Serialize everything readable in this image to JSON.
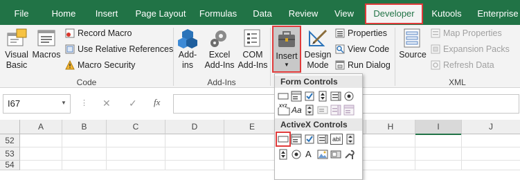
{
  "colors": {
    "brand": "#217346",
    "highlight": "#e03a3a"
  },
  "tabs": [
    "File",
    "Home",
    "Insert",
    "Page Layout",
    "Formulas",
    "Data",
    "Review",
    "View",
    "Developer",
    "Kutools",
    "Enterprise"
  ],
  "active_tab": "Developer",
  "code_group": {
    "label": "Code",
    "visual_basic": [
      "Visual",
      "Basic"
    ],
    "macros": "Macros",
    "record_macro": "Record Macro",
    "use_relative": "Use Relative References",
    "macro_security": "Macro Security"
  },
  "addins_group": {
    "label": "Add-Ins",
    "addins": [
      "Add-",
      "ins"
    ],
    "excel_addins": [
      "Excel",
      "Add-Ins"
    ],
    "com_addins": [
      "COM",
      "Add-Ins"
    ]
  },
  "controls_group": {
    "insert": "Insert",
    "design_mode": [
      "Design",
      "Mode"
    ],
    "properties": "Properties",
    "view_code": "View Code",
    "run_dialog": "Run Dialog"
  },
  "xml_group": {
    "label": "XML",
    "source": "Source",
    "map_properties": "Map Properties",
    "expansion_packs": "Expansion Packs",
    "refresh_data": "Refresh Data"
  },
  "formula_bar": {
    "name_box": "I67",
    "fx": "fx",
    "cancel": "✕",
    "enter": "✓"
  },
  "columns": [
    "A",
    "B",
    "C",
    "D",
    "E",
    "F",
    "G",
    "H",
    "I",
    "J"
  ],
  "rows": [
    "52",
    "53",
    "54"
  ],
  "dropdown": {
    "form_controls": "Form Controls",
    "activex_controls": "ActiveX Controls",
    "xyz": "XYZ",
    "aa": "Aa",
    "abl": "abl",
    "a": "A"
  }
}
